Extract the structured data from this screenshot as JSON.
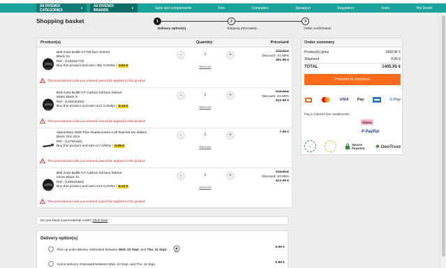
{
  "nav": {
    "category1": "All DIVEMOI CATEGORIES",
    "category2": "All DIVEMOI BRANDS",
    "links": [
      "Suits and complements",
      "Fins",
      "Computers",
      "Speargun",
      "Regulators",
      "Vests",
      "Hot Deals!"
    ]
  },
  "page": {
    "title": "Shopping basket"
  },
  "steps": [
    {
      "num": "1",
      "label": "Delivery option(s)",
      "active": true
    },
    {
      "num": "2",
      "label": "Shipping information",
      "active": false
    },
    {
      "num": "3",
      "label": "Order confirmation",
      "active": false
    }
  ],
  "basket": {
    "col_products": "Product(s)",
    "col_quantity": "Quantity",
    "col_price": "Price/unit",
    "remove_label": "Remove",
    "promo_warning": "The promotional code you entered cannot be applied to this product",
    "items": [
      {
        "name": "Bell moto Bullitt GT full face helmet",
        "variant": "Black XL",
        "ref": "Ref.: (148284770)",
        "earn_pre": "Buy this product and earn 362 CoINNs /",
        "coins": "3.62 €",
        "qty": "1",
        "old_price": "479.95 €",
        "discount": "Discount -24.58%",
        "final_price": "361.99 €"
      },
      {
        "name": "Bell moto Bullitt GT Carbon full face helmet",
        "variant": "Matte Black S",
        "ref": "Ref.: (148025384)",
        "earn_pre": "Buy this product and earn 513 CoINNs /",
        "coins": "5.13 €",
        "qty": "1",
        "old_price": "679.95 €",
        "discount": "Discount -24.55%",
        "final_price": "512.99 €"
      },
      {
        "name": "Alpinestars SMX Plus Replacement Calf Ratchet toe sliders",
        "variant": "Black One Size",
        "ref": "Ref.: (13756156)",
        "earn_pre": "Buy this product and earn 8 CoINNs /",
        "coins": "0.08 €",
        "qty": "1",
        "old_price": "",
        "discount": "",
        "final_price": "7.99 €"
      },
      {
        "name": "Bell moto Bullitt GT Carbon full face helmet",
        "variant": "Gloss Black XL",
        "ref": "Ref.: (148025382)",
        "earn_pre": "Buy this product and earn 513 CoINNs /",
        "coins": "5.13 €",
        "qty": "1",
        "old_price": "679.95 €",
        "discount": "Discount -24.55%",
        "final_price": "512.99 €"
      }
    ]
  },
  "summary": {
    "title": "Order summary",
    "products_label": "Product(s) price",
    "products_value": "1399.96 €",
    "shipping_label": "Shipment",
    "shipping_value": "9.99 €",
    "total_label": "TOTAL",
    "total_value": "1405.95 €",
    "checkout_label": "Proceed to checkout",
    "instalments_label": "Pay in interest free installments:",
    "klarna": "Klarna",
    "paypal": "PayPal",
    "secure_payment": "Secure Payment",
    "geotrust": "GeoTrust"
  },
  "promo": {
    "question": "Do you have a promotional code?",
    "link": "Click here"
  },
  "delivery": {
    "title": "Delivery option(s)",
    "options": [
      {
        "pre": "Pick up point delivery. Estimated between ",
        "date1": "Wed. 10 Sept.",
        "mid": " and ",
        "date2": "Thu. 11 Sept.",
        "price": "5.99 €"
      },
      {
        "pre": "Home delivery. Estimated between Wed. 10 Sept. and Thu. 11 Sept.",
        "date1": "",
        "mid": "",
        "date2": "",
        "price": "9.99 €"
      }
    ]
  },
  "colors": {
    "nav": "#1aa39a",
    "checkout": "#ff6b1a",
    "warning": "#c62828",
    "coin": "#f4d400"
  }
}
